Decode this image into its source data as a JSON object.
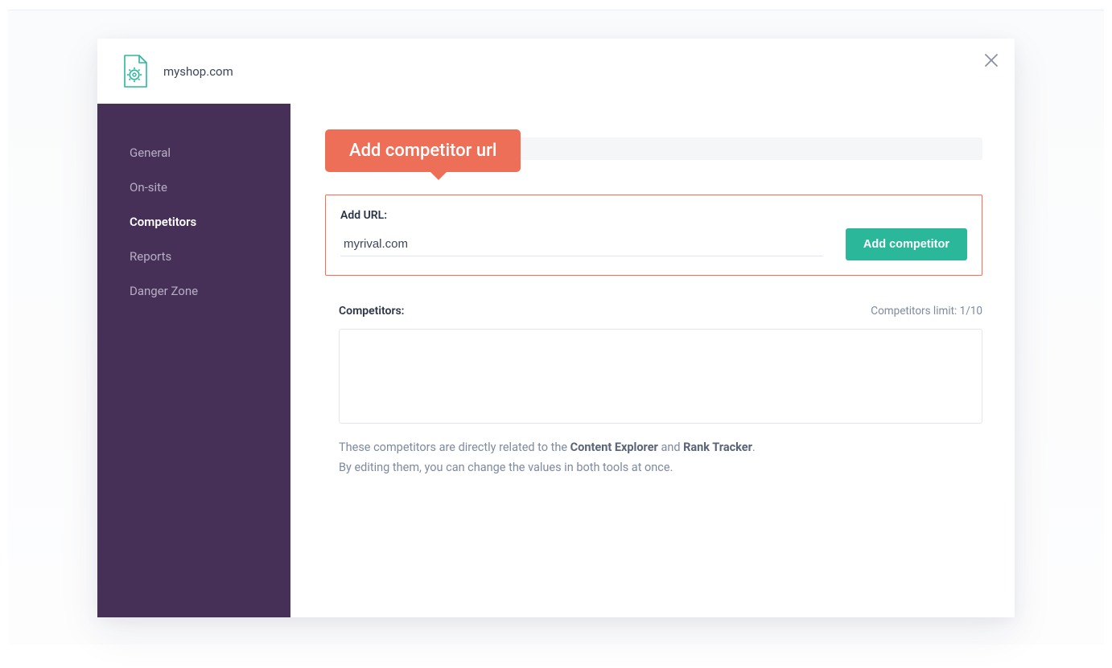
{
  "header": {
    "shop_name": "myshop.com"
  },
  "sidebar": {
    "items": [
      {
        "label": "General"
      },
      {
        "label": "On-site"
      },
      {
        "label": "Competitors"
      },
      {
        "label": "Reports"
      },
      {
        "label": "Danger Zone"
      }
    ],
    "active_index": 2
  },
  "tooltip": {
    "text": "Add competitor url"
  },
  "add_url": {
    "label": "Add URL:",
    "value": "myrival.com",
    "button_label": "Add competitor"
  },
  "competitors": {
    "label": "Competitors:",
    "limit_text": "Competitors limit: 1/10"
  },
  "note": {
    "line1_pre": "These competitors are directly related to the ",
    "line1_b1": "Content Explorer",
    "line1_mid": " and ",
    "line1_b2": "Rank Tracker",
    "line1_post": ".",
    "line2": "By editing them, you can change the values in both tools at once."
  }
}
